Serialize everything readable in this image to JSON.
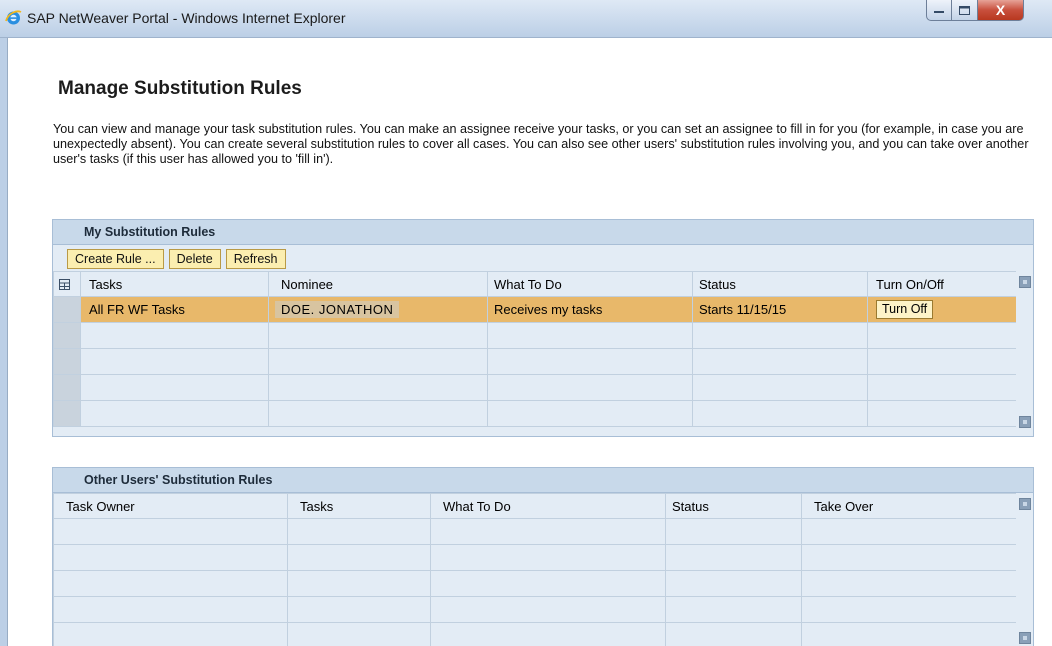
{
  "window": {
    "title": "SAP NetWeaver Portal - Windows Internet Explorer",
    "close_glyph": "X"
  },
  "page": {
    "title": "Manage Substitution Rules",
    "intro": "You can view and manage your task substitution rules. You can make an assignee receive your tasks, or you can set an assignee to fill in for you (for example, in case you are unexpectedly absent). You can create several substitution rules to cover all cases. You can also see other users' substitution rules involving you, and you can take over another user's tasks (if this user has allowed you to 'fill in')."
  },
  "my_rules": {
    "title": "My Substitution Rules",
    "buttons": {
      "create": "Create Rule ...",
      "delete": "Delete",
      "refresh": "Refresh"
    },
    "columns": {
      "tasks": "Tasks",
      "nominee": "Nominee",
      "what": "What To Do",
      "status": "Status",
      "turn": "Turn On/Off"
    },
    "rows": [
      {
        "tasks": "All FR WF Tasks",
        "nominee": "DOE. JONATHON",
        "what": "Receives my tasks",
        "status": "Starts 11/15/15",
        "turn": "Turn Off"
      }
    ]
  },
  "other_rules": {
    "title": "Other Users' Substitution Rules",
    "columns": {
      "owner": "Task Owner",
      "tasks": "Tasks",
      "what": "What To Do",
      "status": "Status",
      "takeover": "Take Over"
    }
  },
  "colors": {
    "highlight_row": "#e8b86a",
    "panel_header": "#c8d9ea",
    "button_bg": "#fbeeb0"
  }
}
